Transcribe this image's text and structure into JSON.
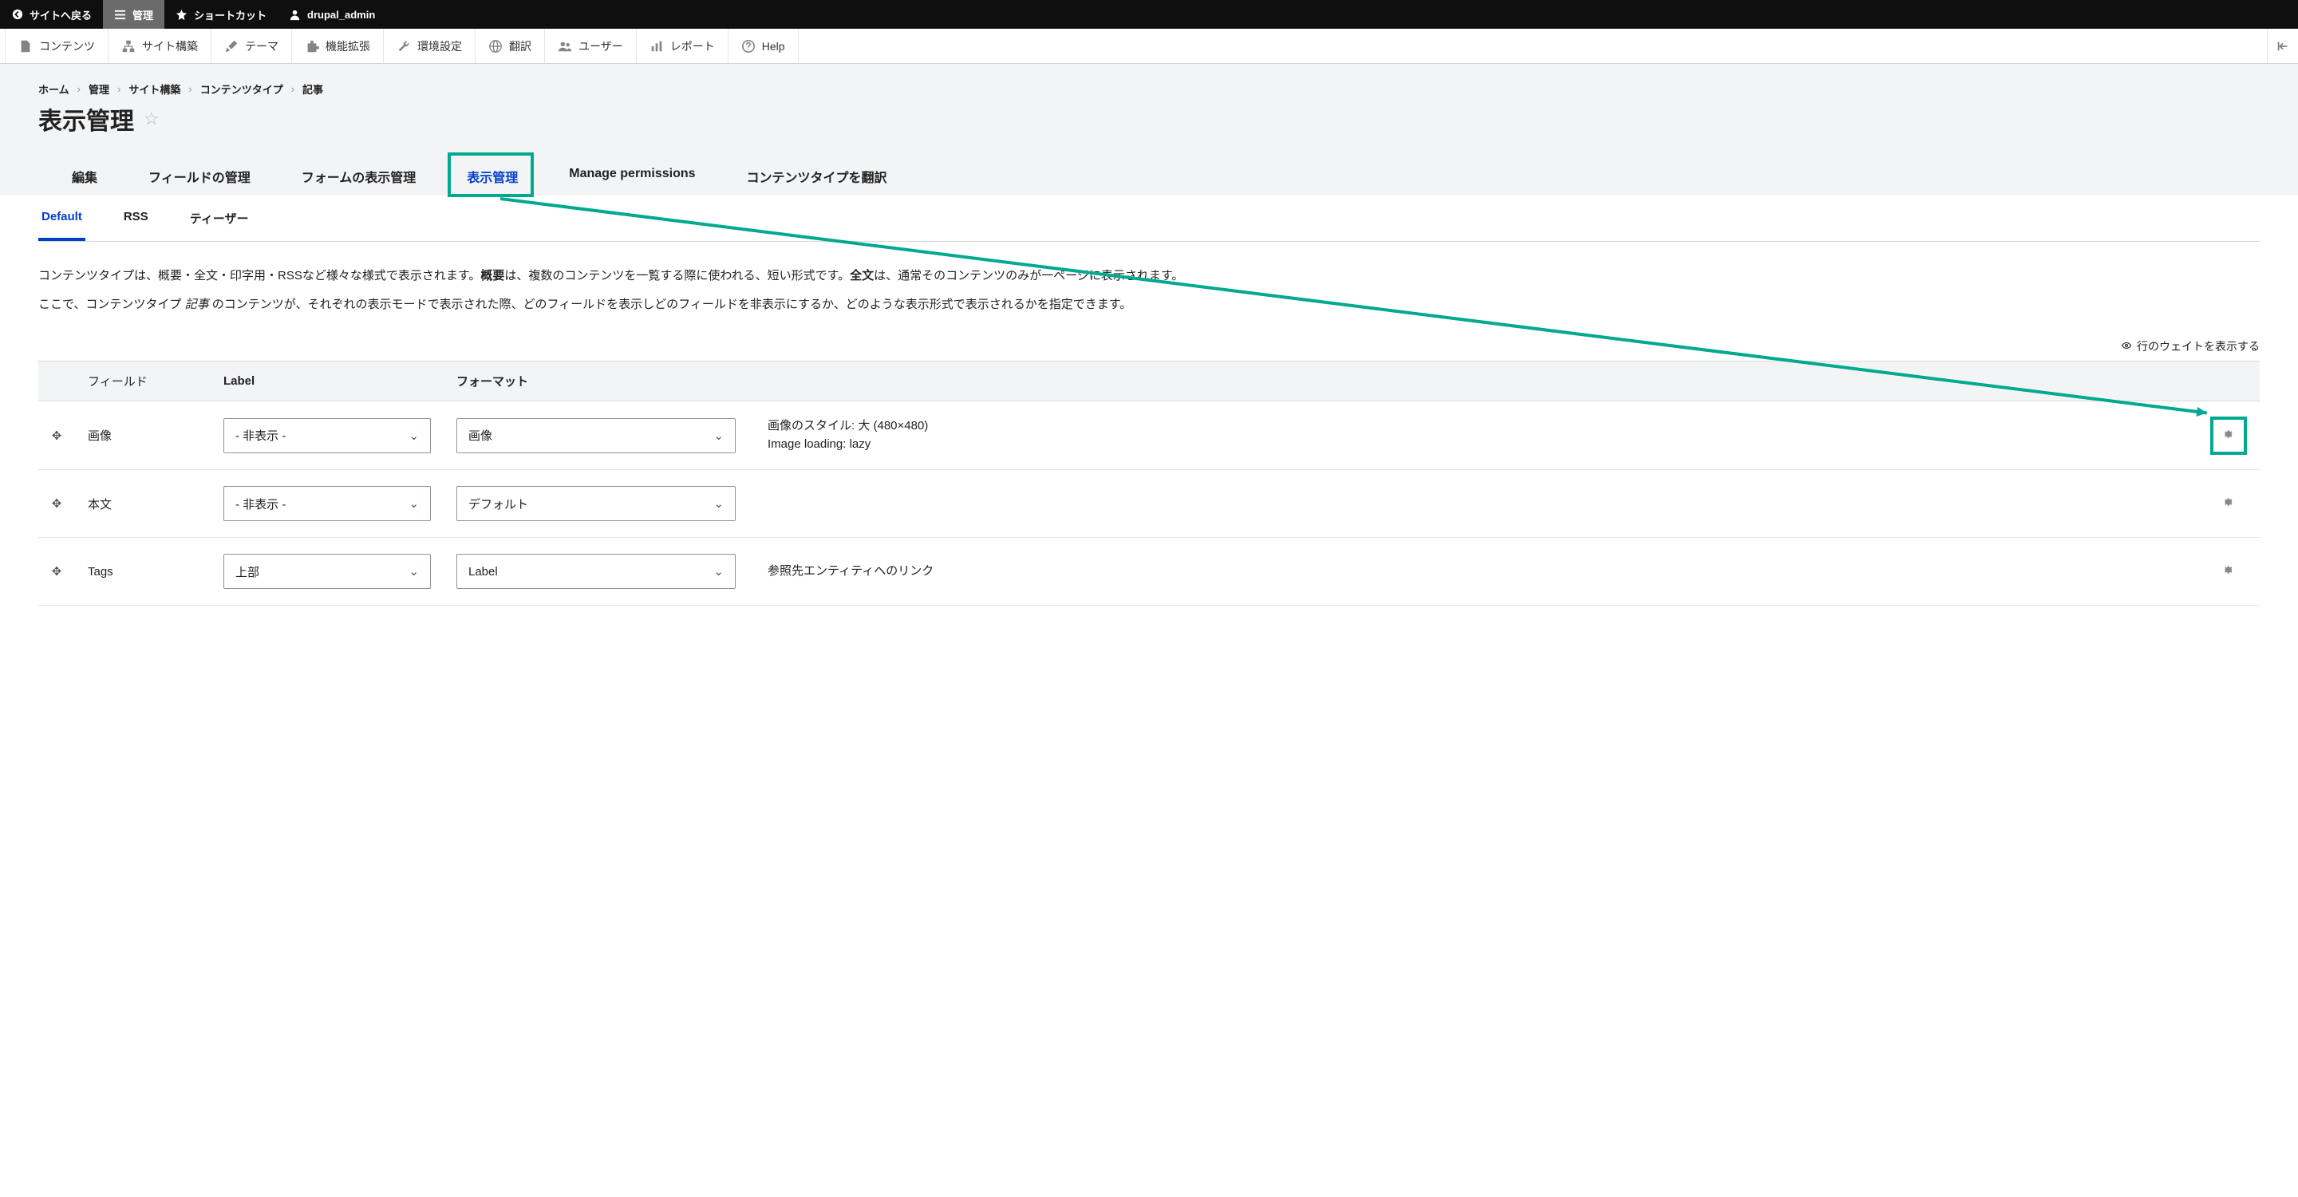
{
  "toolbar": {
    "back": "サイトへ戻る",
    "manage": "管理",
    "shortcuts": "ショートカット",
    "user": "drupal_admin"
  },
  "admin_menu": {
    "content": "コンテンツ",
    "structure": "サイト構築",
    "appearance": "テーマ",
    "extend": "機能拡張",
    "config": "環境設定",
    "translate": "翻訳",
    "people": "ユーザー",
    "reports": "レポート",
    "help": "Help"
  },
  "breadcrumb": [
    "ホーム",
    "管理",
    "サイト構築",
    "コンテンツタイプ",
    "記事"
  ],
  "page_title": "表示管理",
  "primary_tabs": {
    "edit": "編集",
    "fields": "フィールドの管理",
    "form": "フォームの表示管理",
    "display": "表示管理",
    "permissions": "Manage permissions",
    "translate": "コンテンツタイプを翻訳"
  },
  "secondary_tabs": {
    "default": "Default",
    "rss": "RSS",
    "teaser": "ティーザー"
  },
  "desc": {
    "p1a": "コンテンツタイプは、概要・全文・印字用・RSSなど様々な様式で表示されます。",
    "p1b": "概要",
    "p1c": "は、複数のコンテンツを一覧する際に使われる、短い形式です。",
    "p1d": "全文",
    "p1e": "は、通常そのコンテンツのみが一ページに表示されます。",
    "p2a": "ここで、コンテンツタイプ ",
    "p2b": "記事 ",
    "p2c": "のコンテンツが、それぞれの表示モードで表示された際、どのフィールドを表示しどのフィールドを非表示にするか、どのような表示形式で表示されるかを指定できます。"
  },
  "weights_link": "行のウェイトを表示する",
  "table": {
    "h_field": "フィールド",
    "h_label": "Label",
    "h_format": "フォーマット",
    "rows": [
      {
        "field": "画像",
        "label": "- 非表示 -",
        "format": "画像",
        "summary1": "画像のスタイル: 大 (480×480)",
        "summary2": "Image loading: lazy",
        "gear_highlight": true
      },
      {
        "field": "本文",
        "label": "- 非表示 -",
        "format": "デフォルト",
        "summary1": "",
        "summary2": ""
      },
      {
        "field": "Tags",
        "label": "上部",
        "format": "Label",
        "summary1": "参照先エンティティへのリンク",
        "summary2": ""
      }
    ]
  }
}
